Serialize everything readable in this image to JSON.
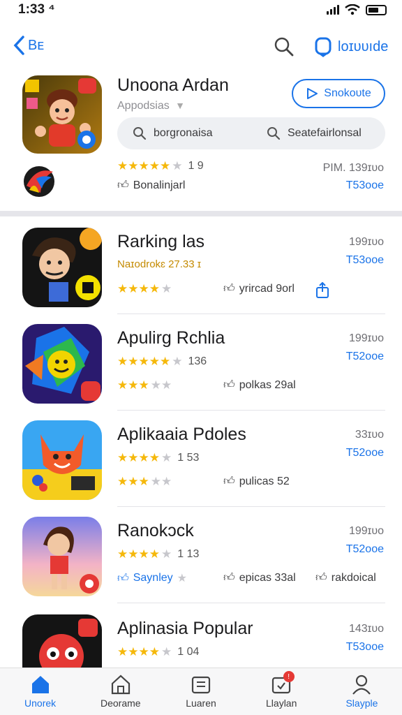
{
  "status": {
    "time": "1:33 ⁴"
  },
  "nav": {
    "back_label": "Bᴇ",
    "action_label": "loɪᴜᴜıde"
  },
  "featured": {
    "title": "Unoona Ardan",
    "subtitle": "Appodsias",
    "get_label": "Snokoᴜte",
    "search_left": "borgronaisa",
    "search_right": "Seatefairlonsal",
    "rating_count": "1 9",
    "like_label": "Bonalinjarl",
    "price_top": "PIM.  139ɪᴜo",
    "price_bottom": "T53ooe"
  },
  "rows": [
    {
      "title": "Rarking las",
      "subtitle": "Naɪodrokɛ 27.33 ɪ",
      "meta": "yrircad 9orl",
      "price_top": "199ɪᴜo",
      "price_bottom": "T53ooe"
    },
    {
      "title": "Apulirg Rchlia",
      "rating_count": "136",
      "meta": "polkas 29al",
      "price_top": "199ɪᴜo",
      "price_bottom": "T52ooe"
    },
    {
      "title": "Aplikaaia Pdoles",
      "rating_count": "1 53",
      "meta": "pulicas 52",
      "price_top": "33ɪᴜo",
      "price_bottom": "T52ooe"
    },
    {
      "title": "Ranokɔck",
      "rating_count": "1 13",
      "like_label": "Saynley",
      "meta": "epicas 33al",
      "meta2": "rakdoical",
      "price_top": "199ɪᴜo",
      "price_bottom": "T52ooe"
    },
    {
      "title": "Aplinasia Popular",
      "rating_count": "1 04",
      "price_top": "143ɪᴜo",
      "price_bottom": "T53ooe"
    }
  ],
  "tabs": [
    {
      "label": "Unorek"
    },
    {
      "label": "Deorame"
    },
    {
      "label": "Luaren"
    },
    {
      "label": "Llaylan"
    },
    {
      "label": "Slayple"
    }
  ]
}
